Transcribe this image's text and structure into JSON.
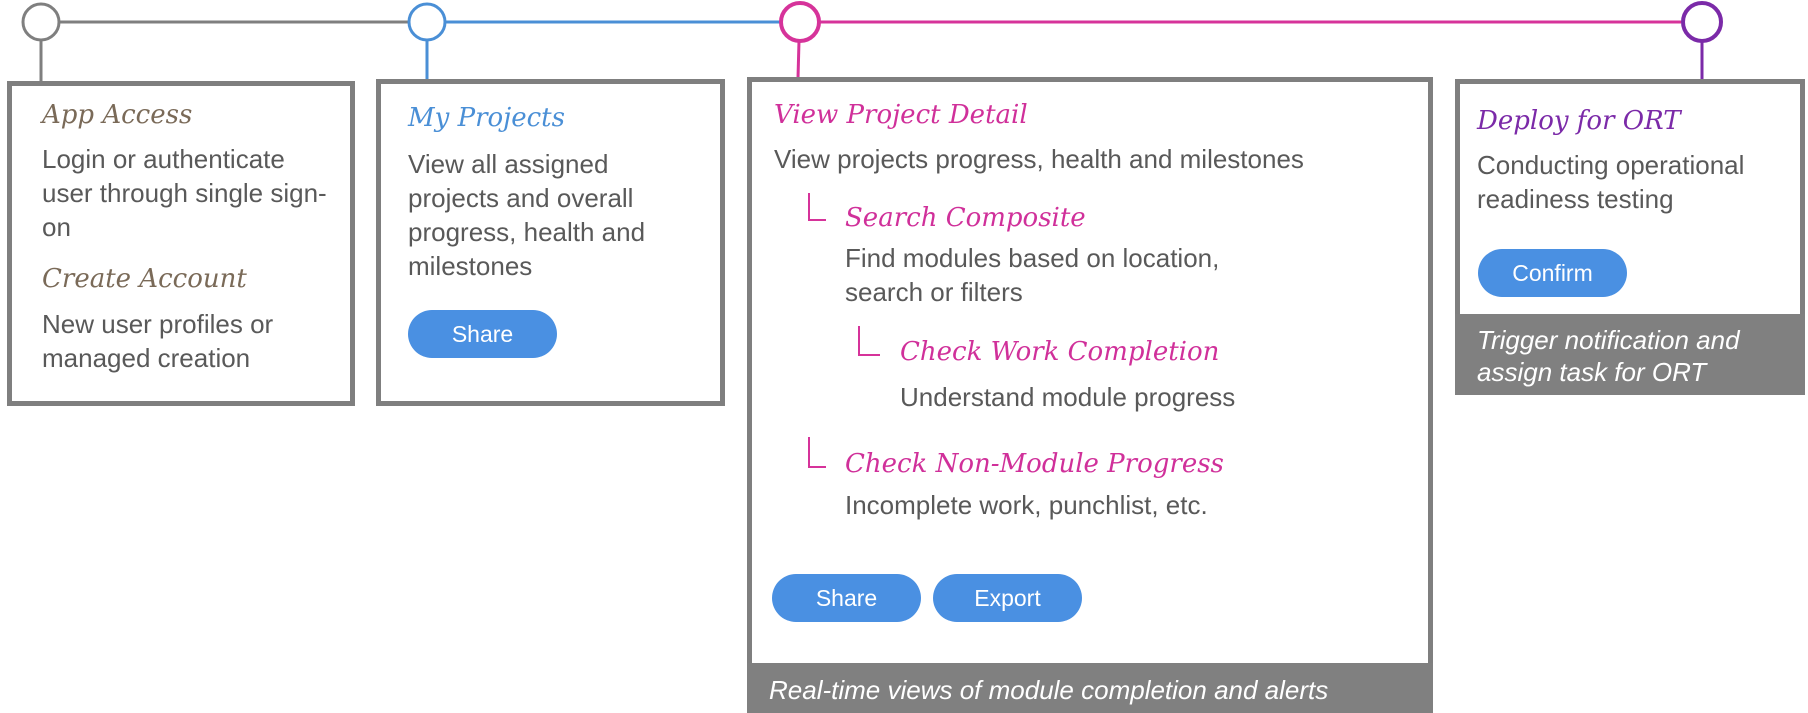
{
  "colors": {
    "gray": "#7f7f7f",
    "blue": "#4a8fd6",
    "pink": "#d6339a",
    "purple": "#7b2aa8",
    "button": "#4a90e2",
    "footer": "#808080"
  },
  "steps": [
    {
      "id": "app-access",
      "sections": [
        {
          "heading": "App Access",
          "text": "Login or authenticate user through single sign-on"
        },
        {
          "heading": "Create Account",
          "text": "New user profiles or managed creation"
        }
      ]
    },
    {
      "id": "my-projects",
      "heading": "My Projects",
      "text": "View all assigned projects and overall progress, health and milestones",
      "buttons": [
        "Share"
      ]
    },
    {
      "id": "view-project-detail",
      "heading": "View Project Detail",
      "text": "View projects progress, health and milestones",
      "children": [
        {
          "heading": "Search Composite",
          "text": "Find modules based on location, search or filters",
          "children": [
            {
              "heading": "Check Work Completion",
              "text": "Understand module progress"
            }
          ]
        },
        {
          "heading": "Check Non-Module Progress",
          "text": "Incomplete work, punchlist, etc."
        }
      ],
      "buttons": [
        "Share",
        "Export"
      ],
      "footer": "Real-time views of module completion and alerts"
    },
    {
      "id": "deploy-for-ort",
      "heading": "Deploy for ORT",
      "text": "Conducting operational readiness testing",
      "buttons": [
        "Confirm"
      ],
      "footer": "Trigger notification and assign task for ORT"
    }
  ]
}
